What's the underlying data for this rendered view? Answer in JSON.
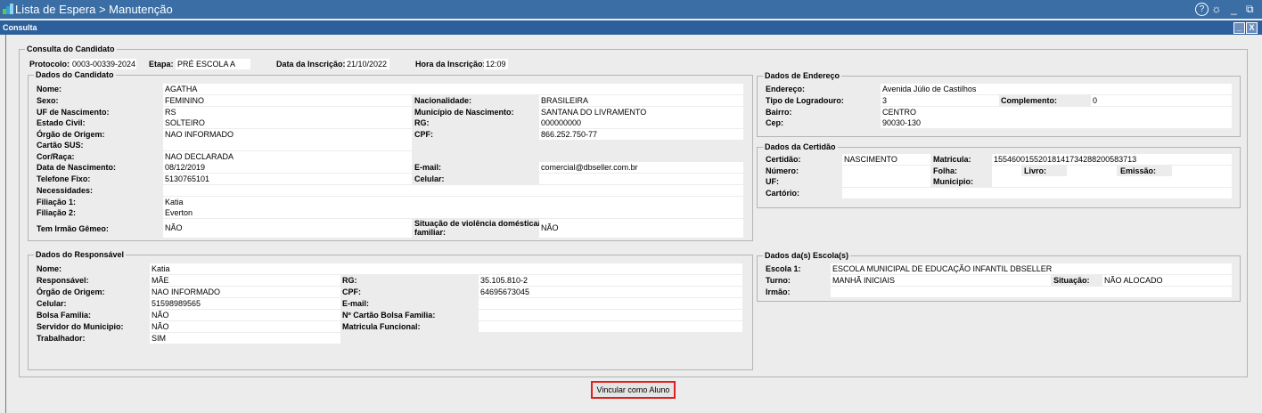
{
  "window": {
    "title": "Lista de Espera > Manutenção",
    "help_glyph": "?",
    "gear_glyph": "☼",
    "min_glyph": "_",
    "restore_glyph": "⧉"
  },
  "subwindow": {
    "title": "Consulta",
    "min_glyph": "_",
    "close_glyph": "X"
  },
  "consulta": {
    "legend": "Consulta do Candidato",
    "protocolo_label": "Protocolo:",
    "protocolo": "0003-00339-2024",
    "etapa_label": "Etapa:",
    "etapa": "PRÉ ESCOLA A",
    "data_label": "Data da Inscrição:",
    "data": "21/10/2022",
    "hora_label": "Hora da Inscrição:",
    "hora": "12:09"
  },
  "candidato": {
    "legend": "Dados do Candidato",
    "nome_label": "Nome:",
    "nome": "AGATHA",
    "sexo_label": "Sexo:",
    "sexo": "FEMININO",
    "nacionalidade_label": "Nacionalidade:",
    "nacionalidade": "BRASILEIRA",
    "uf_label": "UF de Nascimento:",
    "uf": "RS",
    "municipio_label": "Município de Nascimento:",
    "municipio": "SANTANA DO LIVRAMENTO",
    "civil_label": "Estado Civil:",
    "civil": "SOLTEIRO",
    "rg_label": "RG:",
    "rg": "000000000",
    "orgao_label": "Órgão de Origem:",
    "orgao": "NAO INFORMADO",
    "cpf_label": "CPF:",
    "cpf": "866.252.750-77",
    "sus_label": "Cartão SUS:",
    "sus": "",
    "raca_label": "Cor/Raça:",
    "raca": "NAO DECLARADA",
    "nasc_label": "Data de Nascimento:",
    "nasc": "08/12/2019",
    "email_label": "E-mail:",
    "email": "comercial@dbseller.com.br",
    "fone_label": "Telefone Fixo:",
    "fone": "5130765101",
    "celular_label": "Celular:",
    "celular": "",
    "necessidades_label": "Necessidades:",
    "necessidades": "",
    "filiacao1_label": "Filiação 1:",
    "filiacao1": "Katia",
    "filiacao2_label": "Filiação 2:",
    "filiacao2": "Everton",
    "gemeo_label": "Tem Irmão Gêmeo:",
    "gemeo": "NÃO",
    "violencia_label_1": "Situação de violência doméstica/",
    "violencia_label_2": "familiar:",
    "violencia": "NÃO"
  },
  "responsavel": {
    "legend": "Dados do Responsável",
    "nome_label": "Nome:",
    "nome": "Katia",
    "resp_label": "Responsável:",
    "resp": "MÃE",
    "rg_label": "RG:",
    "rg": "35.105.810-2",
    "orgao_label": "Órgão de Origem:",
    "orgao": "NAO INFORMADO",
    "cpf_label": "CPF:",
    "cpf": "64695673045",
    "celular_label": "Celular:",
    "celular": "51598989565",
    "email_label": "E-mail:",
    "email": "",
    "bolsa_label": "Bolsa Familia:",
    "bolsa": "NÃO",
    "cartao_bolsa_label": "Nº Cartão Bolsa Familia:",
    "cartao_bolsa": "",
    "servidor_label": "Servidor do Municipio:",
    "servidor": "NÃO",
    "matricula_label": "Matricula Funcional:",
    "matricula": "",
    "trabalhador_label": "Trabalhador:",
    "trabalhador": "SIM"
  },
  "endereco": {
    "legend": "Dados de Endereço",
    "endereco_label": "Endereço:",
    "endereco": "Avenida Júlio de Castilhos",
    "tipo_label": "Tipo de Logradouro:",
    "tipo": "3",
    "complemento_label": "Complemento:",
    "complemento": "0",
    "bairro_label": "Bairro:",
    "bairro": "CENTRO",
    "cep_label": "Cep:",
    "cep": "90030-130"
  },
  "certidao": {
    "legend": "Dados da Certidão",
    "certidao_label": "Certidão:",
    "certidao": "NASCIMENTO",
    "matricula_label": "Matricula:",
    "matricula": "15546001552018141734288200583713",
    "numero_label": "Número:",
    "numero": "",
    "folha_label": "Folha:",
    "folha": "",
    "livro_label": "Livro:",
    "livro": "",
    "emissao_label": "Emissão:",
    "emissao": "",
    "uf_label": "UF:",
    "uf": "",
    "municipio_label": "Municipio:",
    "municipio": "",
    "cartorio_label": "Cartório:",
    "cartorio": ""
  },
  "escola": {
    "legend": "Dados da(s) Escola(s)",
    "escola1_label": "Escola 1:",
    "escola1": "ESCOLA MUNICIPAL DE EDUCAÇÃO INFANTIL DBSELLER",
    "turno_label": "Turno:",
    "turno": "MANHÃ INICIAIS",
    "situacao_label": "Situação:",
    "situacao": "NÃO ALOCADO",
    "irmao_label": "Irmão:",
    "irmao": ""
  },
  "actions": {
    "vincular_label": "Vincular como Aluno"
  }
}
